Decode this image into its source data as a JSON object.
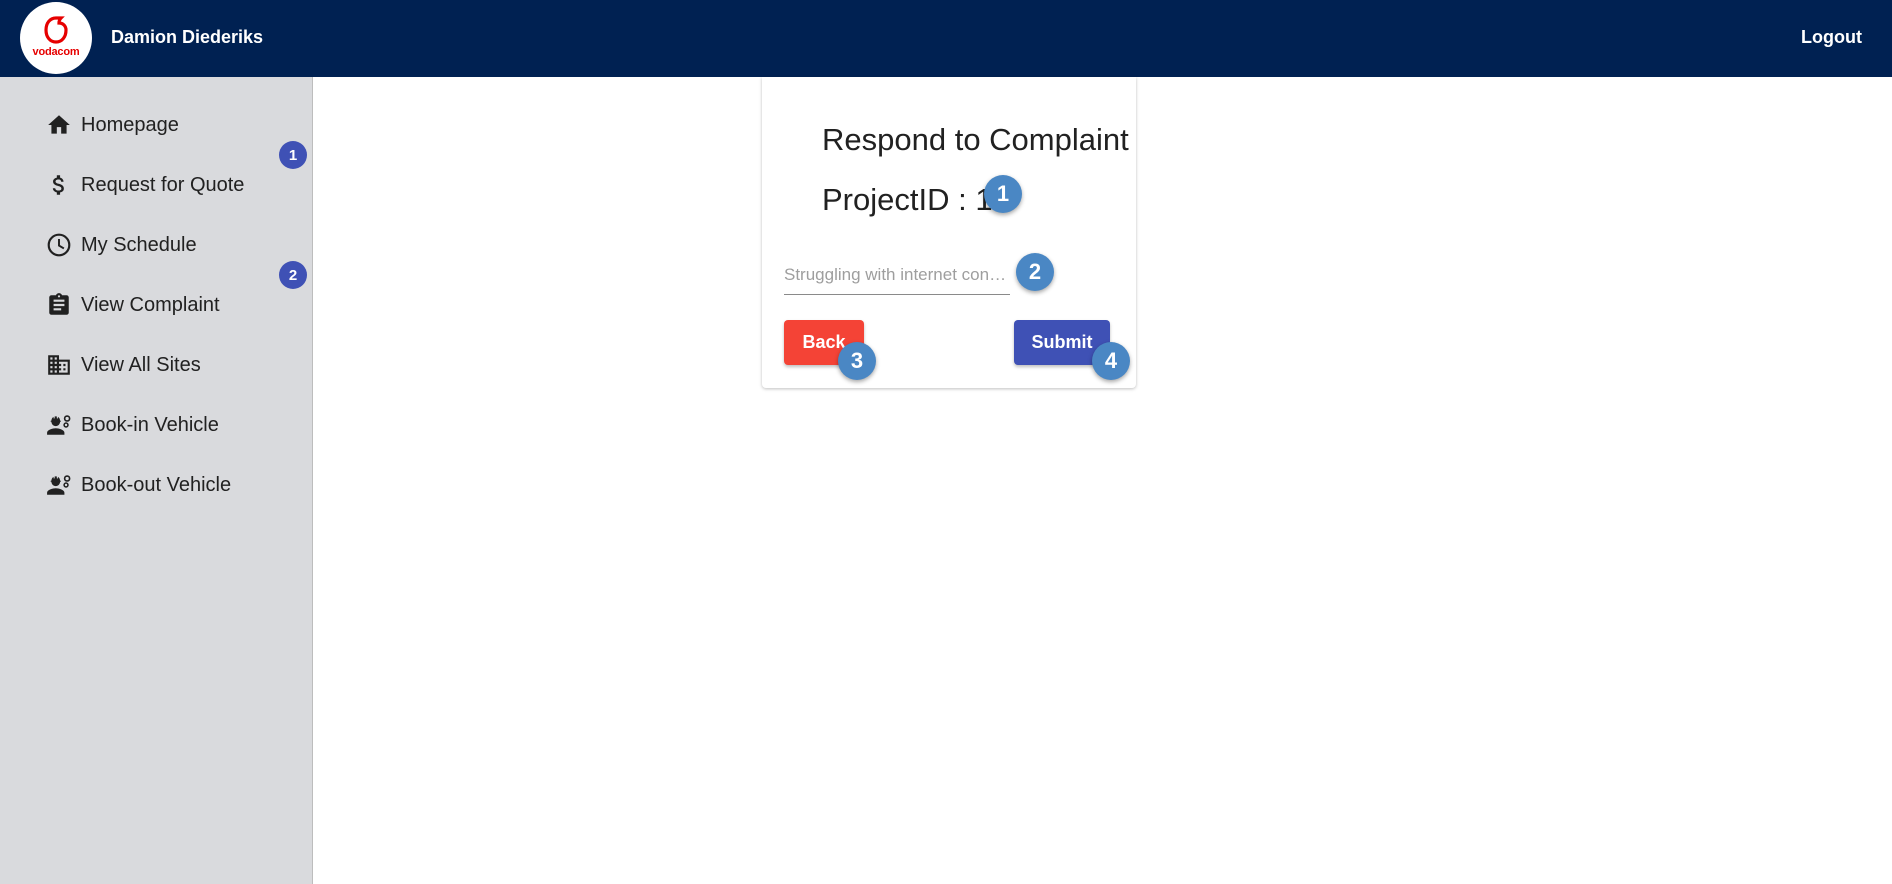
{
  "header": {
    "logo_text": "vodacom",
    "user_name": "Damion Diederiks",
    "logout_label": "Logout"
  },
  "sidebar": {
    "items": [
      {
        "label": "Homepage",
        "icon": "home-icon"
      },
      {
        "label": "Request for Quote",
        "icon": "dollar-icon"
      },
      {
        "label": "My Schedule",
        "icon": "clock-icon"
      },
      {
        "label": "View Complaint",
        "icon": "clipboard-icon"
      },
      {
        "label": "View All Sites",
        "icon": "building-icon"
      },
      {
        "label": "Book-in Vehicle",
        "icon": "engineering-icon"
      },
      {
        "label": "Book-out Vehicle",
        "icon": "engineering-icon"
      }
    ],
    "badges": [
      "1",
      "2"
    ]
  },
  "form": {
    "title": "Respond to Complaint",
    "project_label": "ProjectID : 1",
    "response_placeholder": "Struggling with internet connection",
    "back_label": "Back",
    "submit_label": "Submit"
  },
  "markers": [
    "1",
    "2",
    "3",
    "4"
  ],
  "colors": {
    "header_bg": "#002152",
    "sidebar_bg": "#d9dadd",
    "back_button": "#f44336",
    "submit_button": "#3f51b5",
    "badge": "#3f51b5",
    "marker": "#4a87c4",
    "brand_red": "#e60000"
  }
}
